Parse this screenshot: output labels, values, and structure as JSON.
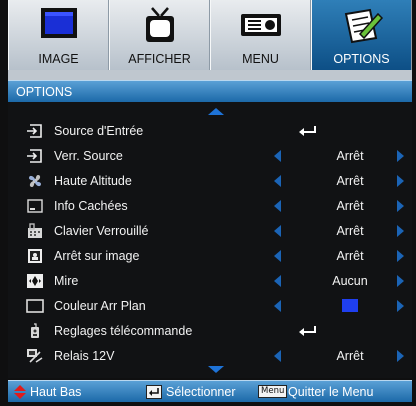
{
  "tabs": [
    {
      "label": "IMAGE",
      "icon": "monitor-icon",
      "active": false
    },
    {
      "label": "AFFICHER",
      "icon": "tv-icon",
      "active": false
    },
    {
      "label": "MENU",
      "icon": "projector-icon",
      "active": false
    },
    {
      "label": "OPTIONS",
      "icon": "notepad-pencil-icon",
      "active": true
    }
  ],
  "title": "OPTIONS",
  "items": [
    {
      "label": "Source d'Entrée",
      "icon": "input-source-icon",
      "control": "enter"
    },
    {
      "label": "Verr. Source",
      "icon": "input-source-icon",
      "value": "Arrêt",
      "control": "arrows"
    },
    {
      "label": "Haute Altitude",
      "icon": "fan-icon",
      "value": "Arrêt",
      "control": "arrows"
    },
    {
      "label": "Info Cachées",
      "icon": "hidden-info-icon",
      "value": "Arrêt",
      "control": "arrows"
    },
    {
      "label": "Clavier Verrouillé",
      "icon": "keypad-lock-icon",
      "value": "Arrêt",
      "control": "arrows"
    },
    {
      "label": "Arrêt sur image",
      "icon": "freeze-icon",
      "value": "Arrêt",
      "control": "arrows"
    },
    {
      "label": "Mire",
      "icon": "test-pattern-icon",
      "value": "Aucun",
      "control": "arrows"
    },
    {
      "label": "Couleur Arr Plan",
      "icon": "background-color-icon",
      "value_color": "#1f3ff0",
      "control": "arrows"
    },
    {
      "label": "Reglages télécommande",
      "icon": "remote-icon",
      "control": "enter"
    },
    {
      "label": "Relais 12V",
      "icon": "relay-12v-icon",
      "value": "Arrêt",
      "control": "arrows"
    }
  ],
  "footer": {
    "nav": "Haut Bas",
    "select": "Sélectionner",
    "menu_key": "Menu",
    "exit": "Quitter le Menu"
  },
  "colors": {
    "accent": "#1c69a8",
    "arrow": "#1b64b6"
  }
}
